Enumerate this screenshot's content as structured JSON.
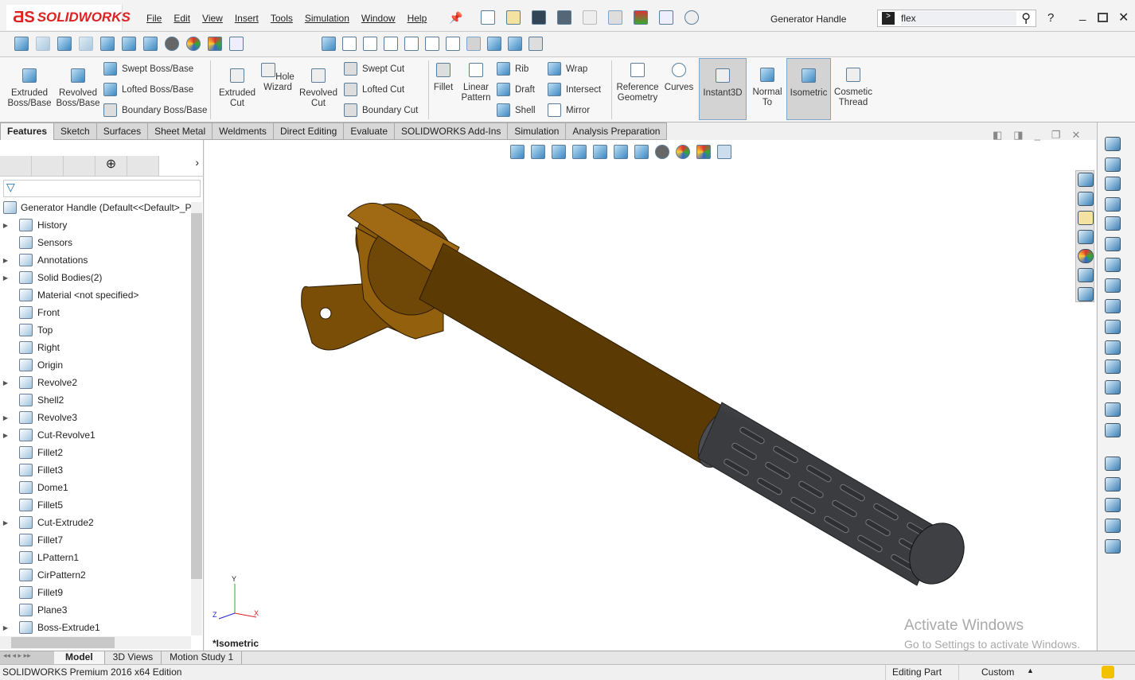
{
  "app": {
    "logo": "SOLIDWORKS",
    "document_title": "Generator Handle",
    "search_value": "flex"
  },
  "menu": [
    "File",
    "Edit",
    "View",
    "Insert",
    "Tools",
    "Simulation",
    "Window",
    "Help"
  ],
  "ribbon": {
    "large": [
      {
        "label": "Extruded Boss/Base"
      },
      {
        "label": "Revolved Boss/Base"
      },
      {
        "label": "Extruded Cut"
      },
      {
        "label": "Hole Wizard"
      },
      {
        "label": "Revolved Cut"
      },
      {
        "label": "Fillet"
      },
      {
        "label": "Linear Pattern"
      },
      {
        "label": "Reference Geometry"
      },
      {
        "label": "Curves"
      },
      {
        "label": "Instant3D"
      },
      {
        "label": "Normal To"
      },
      {
        "label": "Isometric"
      },
      {
        "label": "Cosmetic Thread"
      }
    ],
    "small": [
      "Swept Boss/Base",
      "Lofted Boss/Base",
      "Boundary Boss/Base",
      "Swept Cut",
      "Lofted Cut",
      "Boundary Cut",
      "Rib",
      "Draft",
      "Shell",
      "Wrap",
      "Intersect",
      "Mirror"
    ]
  },
  "tabs": [
    "Features",
    "Sketch",
    "Surfaces",
    "Sheet Metal",
    "Weldments",
    "Direct Editing",
    "Evaluate",
    "SOLIDWORKS Add-Ins",
    "Simulation",
    "Analysis Preparation"
  ],
  "tree": {
    "root": "Generator Handle  (Default<<Default>_P",
    "items": [
      {
        "label": "History",
        "exp": true
      },
      {
        "label": "Sensors",
        "exp": false
      },
      {
        "label": "Annotations",
        "exp": true
      },
      {
        "label": "Solid Bodies(2)",
        "exp": true
      },
      {
        "label": "Material <not specified>",
        "exp": false
      },
      {
        "label": "Front",
        "exp": false
      },
      {
        "label": "Top",
        "exp": false
      },
      {
        "label": "Right",
        "exp": false
      },
      {
        "label": "Origin",
        "exp": false
      },
      {
        "label": "Revolve2",
        "exp": true
      },
      {
        "label": "Shell2",
        "exp": false
      },
      {
        "label": "Revolve3",
        "exp": true
      },
      {
        "label": "Cut-Revolve1",
        "exp": true
      },
      {
        "label": "Fillet2",
        "exp": false
      },
      {
        "label": "Fillet3",
        "exp": false
      },
      {
        "label": "Dome1",
        "exp": false
      },
      {
        "label": "Fillet5",
        "exp": false
      },
      {
        "label": "Cut-Extrude2",
        "exp": true
      },
      {
        "label": "Fillet7",
        "exp": false
      },
      {
        "label": "LPattern1",
        "exp": false
      },
      {
        "label": "CirPattern2",
        "exp": false
      },
      {
        "label": "Fillet9",
        "exp": false
      },
      {
        "label": "Plane3",
        "exp": false
      },
      {
        "label": "Boss-Extrude1",
        "exp": true
      }
    ]
  },
  "viewport": {
    "view_name": "*Isometric",
    "watermark_title": "Activate Windows",
    "watermark_sub": "Go to Settings to activate Windows.",
    "triad": [
      "Y",
      "Z",
      "X"
    ]
  },
  "bottom_tabs": [
    "Model",
    "3D Views",
    "Motion Study 1"
  ],
  "status": {
    "edition": "SOLIDWORKS Premium 2016 x64 Edition",
    "mode": "Editing Part",
    "units": "Custom"
  },
  "colors": {
    "body": "#8a5a08",
    "grip": "#5a5d62",
    "accent": "#d22222"
  }
}
